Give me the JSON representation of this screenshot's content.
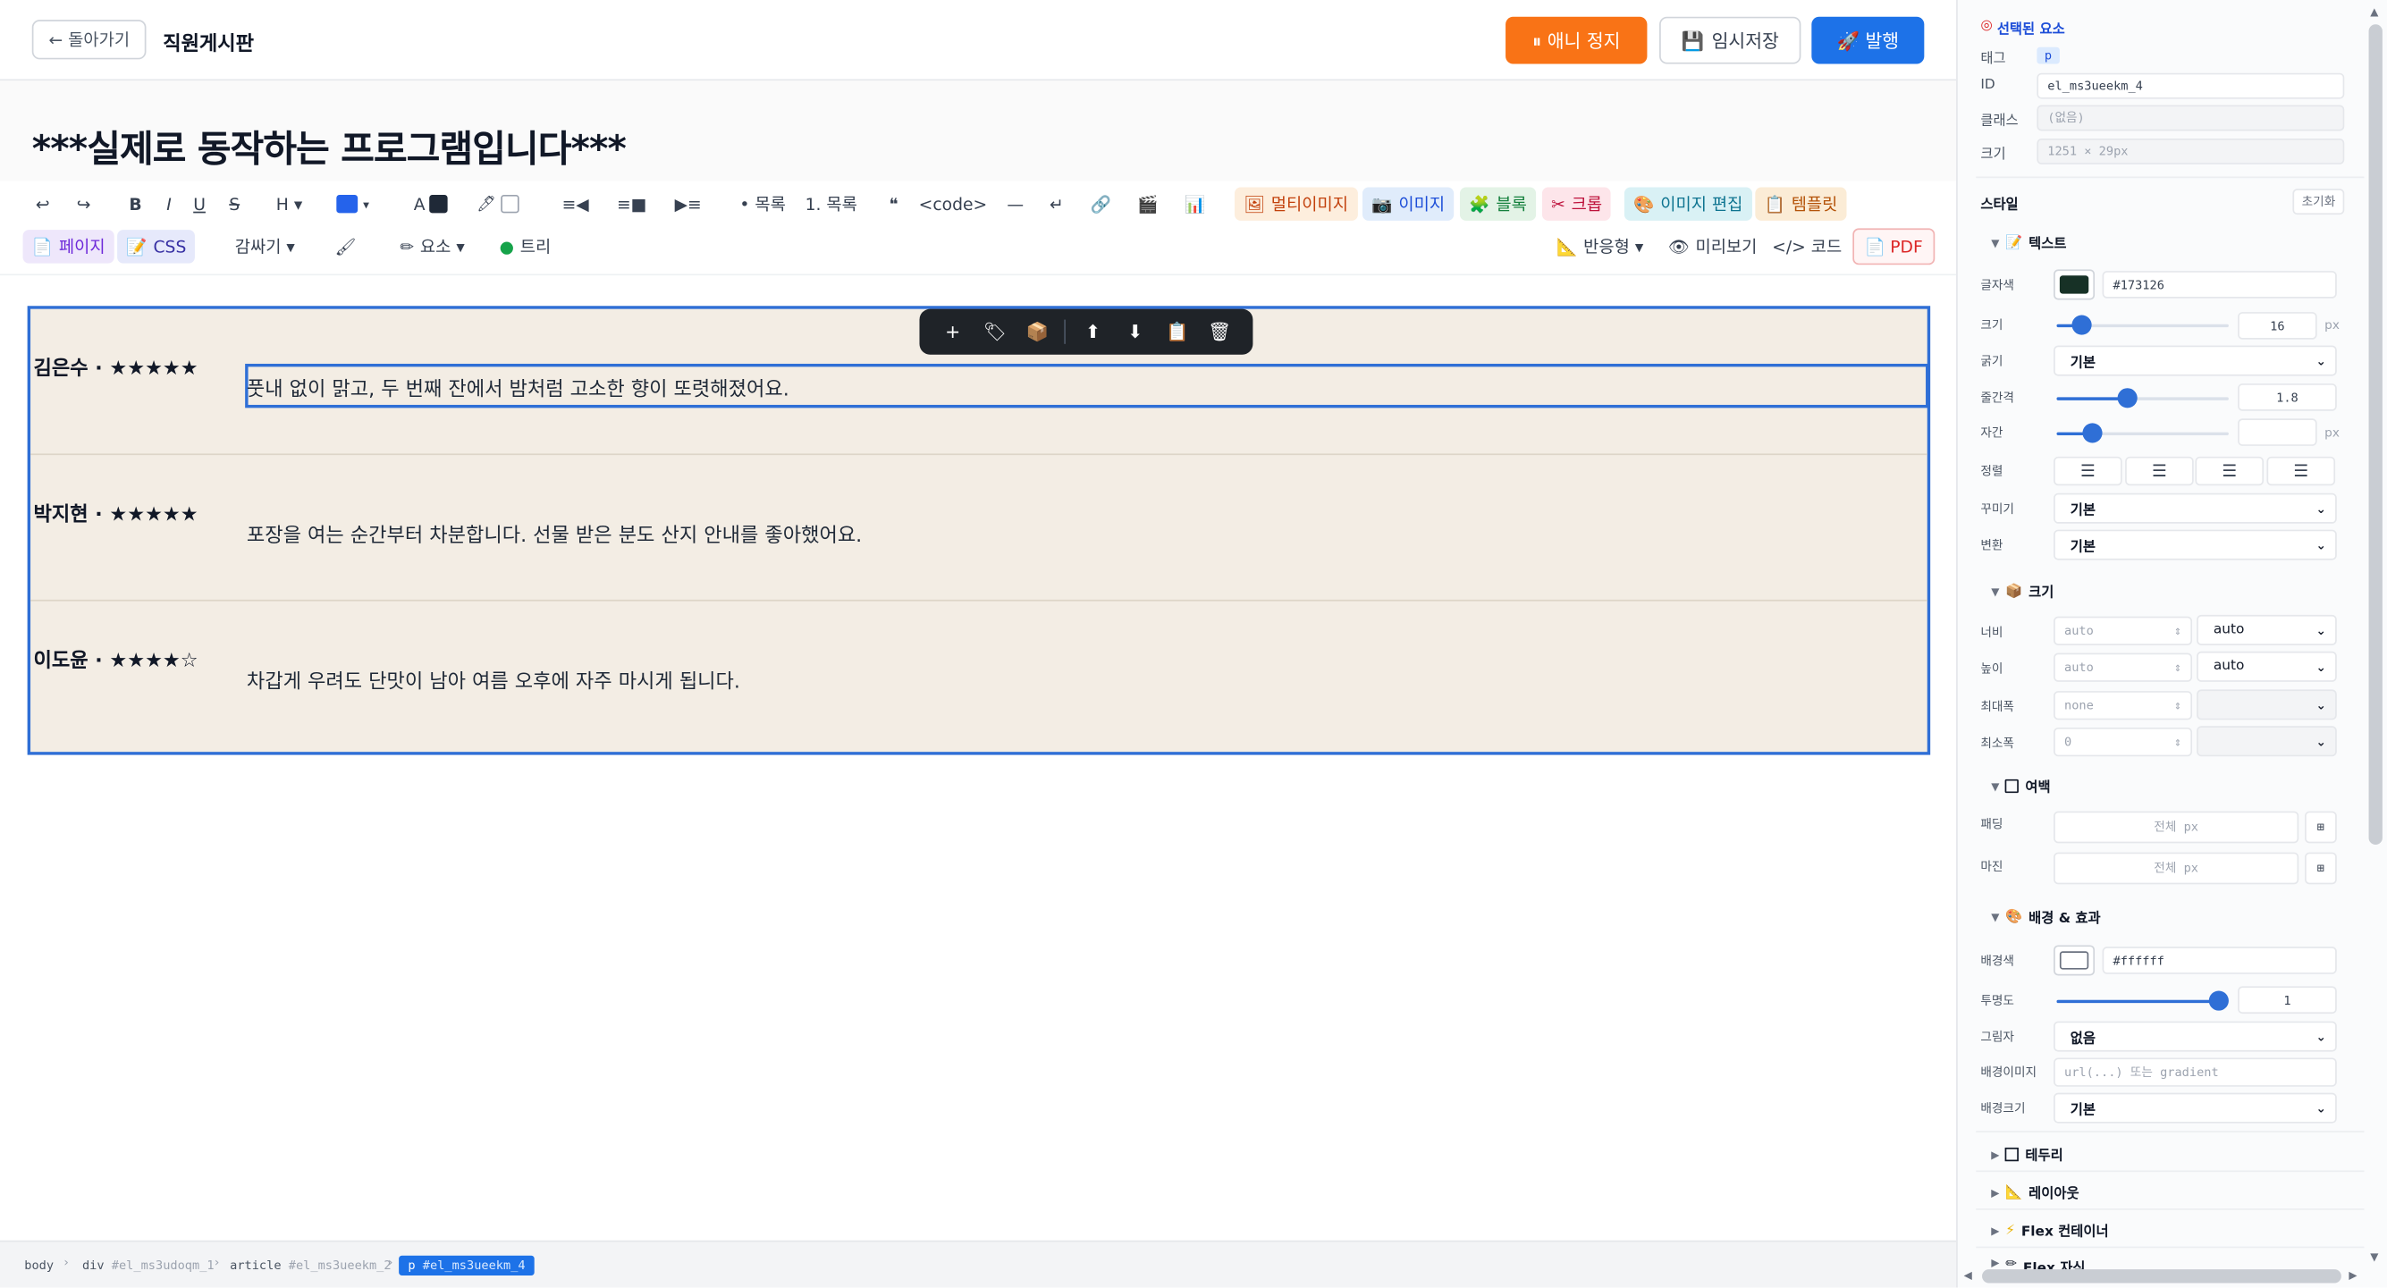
{
  "header": {
    "back_label": "← 돌아가기",
    "board_title": "직원게시판",
    "anim_stop_label": "⏸ 애니 정지",
    "save_label": "임시저장",
    "publish_label": "🚀 발행"
  },
  "document": {
    "title": "***실제로 동작하는 프로그램입니다***"
  },
  "toolbar": {
    "row1": {
      "undo": "↩",
      "redo": "↪",
      "bold": "B",
      "italic": "I",
      "underline": "U",
      "strike": "S",
      "heading": "H ▾",
      "block_color": "▾",
      "font_color": "A",
      "highlight": "🖊",
      "outdent": "≡◀",
      "align": "≡■",
      "indent": "▶≡",
      "bullet_list": "• 목록",
      "number_list": "1. 목록",
      "quote": "❝",
      "code": "<code>",
      "hr": "—",
      "line_break": "↵",
      "link": "🔗",
      "video": "🎬",
      "chart": "📊",
      "multi_image": "멀티이미지",
      "image": "이미지",
      "block": "블록",
      "crop": "크롭",
      "image_edit": "이미지 편집",
      "template": "템플릿"
    },
    "row2": {
      "page": "페이지",
      "css": "CSS",
      "wrap": "감싸기 ▾",
      "brush": "🖌",
      "element": "요소 ▾",
      "tree": "트리",
      "responsive": "반응형 ▾",
      "preview": "미리보기",
      "code": "</> 코드",
      "pdf": "PDF"
    }
  },
  "reviews": [
    {
      "reviewer": "김은수 · ★★★★★",
      "text": "풋내 없이 맑고, 두 번째 잔에서 밤처럼 고소한 향이 또렷해졌어요."
    },
    {
      "reviewer": "박지현 · ★★★★★",
      "text": "포장을 여는 순간부터 차분합니다. 선물 받은 분도 산지 안내를 좋아했어요."
    },
    {
      "reviewer": "이도윤 · ★★★★☆",
      "text": "차갑게 우려도 단맛이 남아 여름 오후에 자주 마시게 됩니다."
    }
  ],
  "floating_toolbar": [
    "+",
    "🏷",
    "📦",
    "⬆",
    "⬇",
    "📋",
    "🗑"
  ],
  "breadcrumb": [
    {
      "tag": "body",
      "id": ""
    },
    {
      "tag": "div",
      "id": "#el_ms3udoqm_1"
    },
    {
      "tag": "article",
      "id": "#el_ms3ueekm_2"
    },
    {
      "tag": "p",
      "id": "#el_ms3ueekm_4"
    }
  ],
  "panel": {
    "selected_title": "선택된 요소",
    "tag_label": "태그",
    "tag_value": "p",
    "id_label": "ID",
    "id_value": "el_ms3ueekm_4",
    "class_label": "클래스",
    "class_value": "(없음)",
    "size_label": "크기",
    "size_value": "1251 × 29px",
    "style_title": "스타일",
    "reset_label": "초기화",
    "text_section": "텍스트",
    "font_color_label": "글자색",
    "font_color_value": "#173126",
    "font_size_label": "크기",
    "font_size_value": "16",
    "px": "px",
    "weight_label": "굵기",
    "weight_value": "기본",
    "line_height_label": "줄간격",
    "line_height_value": "1.8",
    "letter_spacing_label": "자간",
    "letter_spacing_value": "",
    "align_label": "정렬",
    "decoration_label": "꾸미기",
    "decoration_value": "기본",
    "transform_label": "변환",
    "transform_value": "기본",
    "size_section": "크기",
    "width_label": "너비",
    "width_value": "auto",
    "width_unit": "auto",
    "height_label": "높이",
    "height_value": "auto",
    "height_unit": "auto",
    "max_width_label": "최대폭",
    "max_width_value": "none",
    "min_width_label": "최소폭",
    "min_width_value": "0",
    "spacing_section": "여백",
    "padding_label": "패딩",
    "padding_placeholder": "전체 px",
    "margin_label": "마진",
    "margin_placeholder": "전체 px",
    "bg_section": "배경 & 효과",
    "bg_color_label": "배경색",
    "bg_color_value": "#ffffff",
    "opacity_label": "투명도",
    "opacity_value": "1",
    "shadow_label": "그림자",
    "shadow_value": "없음",
    "bg_image_label": "배경이미지",
    "bg_image_placeholder": "url(...) 또는 gradient",
    "bg_size_label": "배경크기",
    "bg_size_value": "기본",
    "border_section": "테두리",
    "layout_section": "레이아웃",
    "flex_section": "Flex 컨테이너",
    "flex_child_section": "Flex 자식"
  },
  "colors": {
    "accent": "#1d72e8",
    "orange": "#f97316",
    "article_bg": "#f3ede4",
    "text_color": "#173126"
  }
}
